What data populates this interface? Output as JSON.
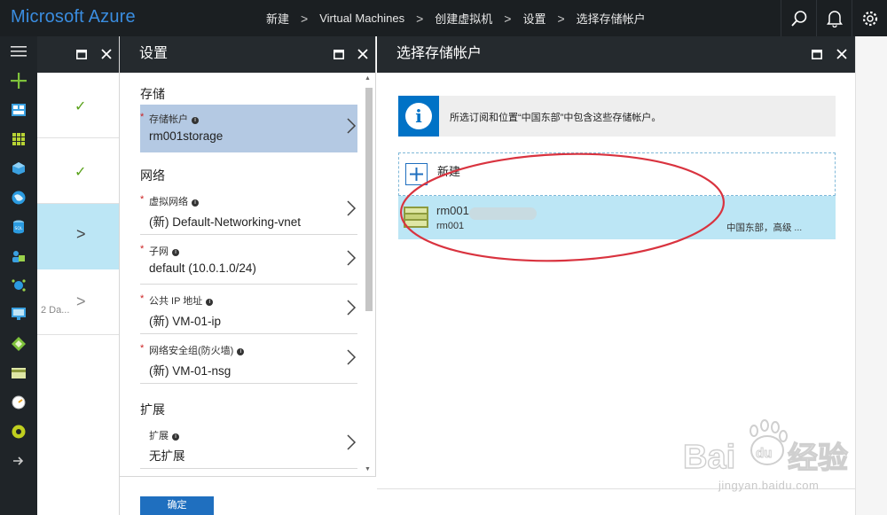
{
  "topbar": {
    "brand": "Microsoft Azure",
    "breadcrumbs": [
      "新建",
      "Virtual Machines",
      "创建虚拟机",
      "设置",
      "选择存储帐户"
    ],
    "icons": [
      "search-icon",
      "bell-icon",
      "gear-icon"
    ]
  },
  "rail": {
    "icons": [
      "hamburger-menu-icon",
      "plus-icon",
      "dashboard-icon",
      "grid-icon",
      "cube-icon",
      "globe-icon",
      "sql-icon",
      "people-icon",
      "network-icon",
      "monitor-icon",
      "diamond-icon",
      "card-icon",
      "gauge-icon",
      "circle-icon",
      "arrow-icon"
    ]
  },
  "blade0": {
    "items": [
      {
        "status": "✓"
      },
      {
        "status": "✓"
      },
      {
        "status": "selected"
      },
      {
        "text": "2 Da..."
      }
    ]
  },
  "settings": {
    "title": "设置",
    "sections": {
      "storage": "存储",
      "network": "网络",
      "extensions": "扩展"
    },
    "rows": [
      {
        "label": "存储帐户",
        "value": "rm001storage",
        "required": "*"
      },
      {
        "label": "虚拟网络",
        "value": "(新) Default-Networking-vnet",
        "required": "*"
      },
      {
        "label": "子网",
        "value": "default (10.0.1.0/24)",
        "required": "*"
      },
      {
        "label": "公共 IP 地址",
        "value": "(新) VM-01-ip",
        "required": "*"
      },
      {
        "label": "网络安全组(防火墙)",
        "value": "(新) VM-01-nsg",
        "required": "*"
      },
      {
        "label": "扩展",
        "value": "无扩展",
        "required": ""
      }
    ],
    "ok_label": "确定"
  },
  "storage_picker": {
    "title": "选择存储帐户",
    "info_text": "所选订阅和位置“中国东部”中包含这些存储帐户。",
    "new_label": "新建",
    "accounts": [
      {
        "name": "rm001",
        "sub": "rm001",
        "location": "中国东部，高级 ..."
      }
    ]
  },
  "watermark": {
    "logo": "Bai du 经验",
    "url": "jingyan.baidu.com"
  },
  "colors": {
    "topbar": "#1b1f22",
    "brand": "#3a8de0",
    "selected_row": "#b4c9e3",
    "account_row": "#bce6f5",
    "accent": "#0072c6",
    "check": "#5aa21b",
    "annotation": "#d9333f"
  }
}
